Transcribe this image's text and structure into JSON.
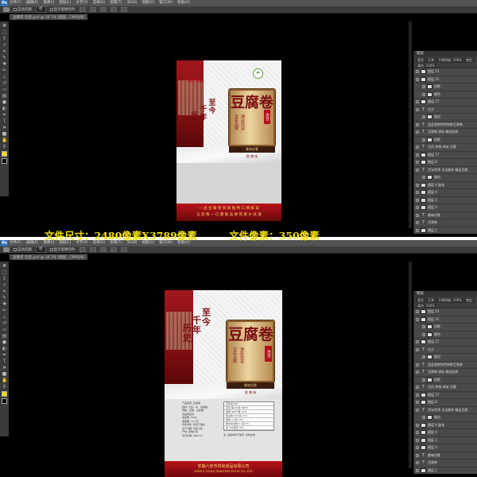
{
  "menubar": {
    "items": [
      "文件(F)",
      "编辑(E)",
      "图像(I)",
      "图层(L)",
      "文字(Y)",
      "选择(S)",
      "滤镜(T)",
      "3D(D)",
      "视图(V)",
      "窗口(W)",
      "帮助(H)"
    ],
    "logo": "Ps"
  },
  "options_bar": {
    "auto_select": "自动选择",
    "layer_select": "组",
    "transform_controls": "显示变换控件"
  },
  "doc_tab_top": "豆腐卷 包装.psd @ 16.7% (图层 , CMYK/8)",
  "doc_tab_bottom": "豆腐卷 包装.psd @ 16.7% (图层 , CMYK/8)",
  "layers_panel": {
    "title": "图层",
    "kind": "类型",
    "mode": "正常",
    "opacity": "不透明度: 100%",
    "fill": "填充: 100%",
    "lock": "锁定:",
    "top_layers": [
      "图层 53",
      "图层 35",
      "投影",
      "颜色",
      "图层 27",
      "古方",
      "描边",
      "温县香斯特色新鲜豆腐卷",
      "豆腐卷 原料 精选优质",
      "投影",
      "古风 传统 风味 豆腐",
      "图层 17",
      "图层 8",
      "百年传承 古法制作 精品豆腐",
      "描边",
      "图层 4 副本",
      "图层 4",
      "图层 3",
      "图层 2",
      "美味佳肴",
      "豆腐卷",
      "图层 1"
    ],
    "bottom_layers": [
      "图层 53",
      "图层 35",
      "投影",
      "颜色",
      "图层 27",
      "古方",
      "描边",
      "温县香斯特色新鲜豆腐卷",
      "豆腐卷 原料 精选优质",
      "投影",
      "古风 传统 风味 豆腐",
      "图层 17",
      "图层 8",
      "百年传承 古法制作 精品豆腐",
      "描边",
      "图层 4 副本",
      "图层 4",
      "图层 3",
      "图层 2",
      "美味佳肴",
      "豆腐卷",
      "图层 1"
    ]
  },
  "package": {
    "brand_top": "百年食品",
    "calligraphy_lines": [
      "至今",
      "千年",
      "历史"
    ],
    "main_title": "豆腐卷",
    "seal_text": "古方",
    "tagline_left": "百年品牌",
    "tagline_right": "薄皮劲道",
    "banner_text": "美味佳肴",
    "subline": "香 辣 味",
    "bottom_lines_top": [
      "一 品 豆 腐 卷 风 味 独 特 口 感 鲜 美",
      "让 您 每 一 口 都 能 品 尝 到 家 乡 味 道"
    ],
    "company_cn": "安徽六安市祥和食品有限公司",
    "company_en": "ANHUI LIUAN XIANGHE FOOD CO.,LTD",
    "ingredients": [
      "产品名称: 豆腐卷",
      "配料: 大豆、水、食用盐、",
      "辣椒、花椒、白砂糖、",
      "食品添加剂",
      "净含量: 500g",
      "保质期: 12个月",
      "贮存条件: 阴凉干燥处",
      "生产日期: 见封口处",
      "产地: 安徽六安",
      "执行标准: GB2712"
    ],
    "nutrition_rows": [
      "营养成分表",
      "项目 每100克 NRV%",
      "能量 860千焦 10%",
      "蛋白质 18.5克 31%",
      "脂肪 9.2克 15%",
      "碳水化合物 6.1克 2%",
      "钠 780毫克 39%"
    ],
    "note": "注: 包装内有干燥剂, 请勿食用"
  },
  "caption": {
    "size_text": "文件尺寸：2480像素X3789像素",
    "dpi_text": "文件像素：350像素"
  }
}
